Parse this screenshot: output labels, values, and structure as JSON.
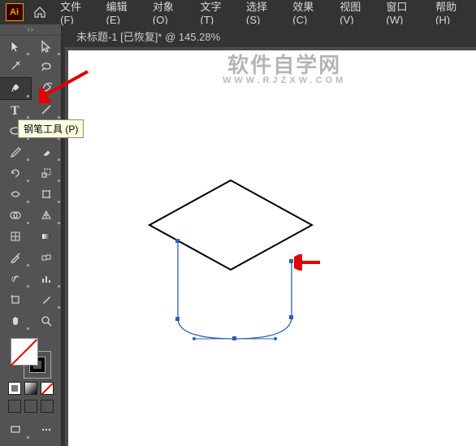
{
  "app": {
    "id": "Ai"
  },
  "menu": {
    "file": "文件(F)",
    "edit": "编辑(E)",
    "object": "对象(O)",
    "type": "文字(T)",
    "select": "选择(S)",
    "effect": "效果(C)",
    "view": "视图(V)",
    "window": "窗口(W)",
    "help": "帮助(H)"
  },
  "tab": {
    "title": "未标题-1 [已恢复]* @ 145.28%"
  },
  "tooltip": {
    "pen": "钢笔工具 (P)"
  },
  "watermark": {
    "main": "软件自学网",
    "sub": "WWW.RJZXW.COM"
  },
  "tools": {
    "selection": "selection-tool",
    "direct": "direct-selection-tool",
    "wand": "magic-wand-tool",
    "lasso": "lasso-tool",
    "pen": "pen-tool",
    "curvature": "curvature-tool",
    "type": "type-tool",
    "line": "line-tool",
    "ellipse": "ellipse-tool",
    "brush": "brush-tool",
    "shaper": "shaper-tool",
    "eraser": "eraser-tool",
    "rotate": "rotate-tool",
    "scale": "scale-tool",
    "width": "width-tool",
    "free": "free-transform-tool",
    "shapebuilder": "shape-builder-tool",
    "perspective": "perspective-tool",
    "mesh": "mesh-tool",
    "gradient": "gradient-tool",
    "eyedropper": "eyedropper-tool",
    "blend": "blend-tool",
    "symbol": "symbol-sprayer-tool",
    "graph": "graph-tool",
    "artboard": "artboard-tool",
    "slice": "slice-tool",
    "hand": "hand-tool",
    "zoom": "zoom-tool"
  },
  "colors": {
    "accent": "#ff9a00",
    "anchor": "#2b5fb4",
    "arrow": "#e30000"
  }
}
